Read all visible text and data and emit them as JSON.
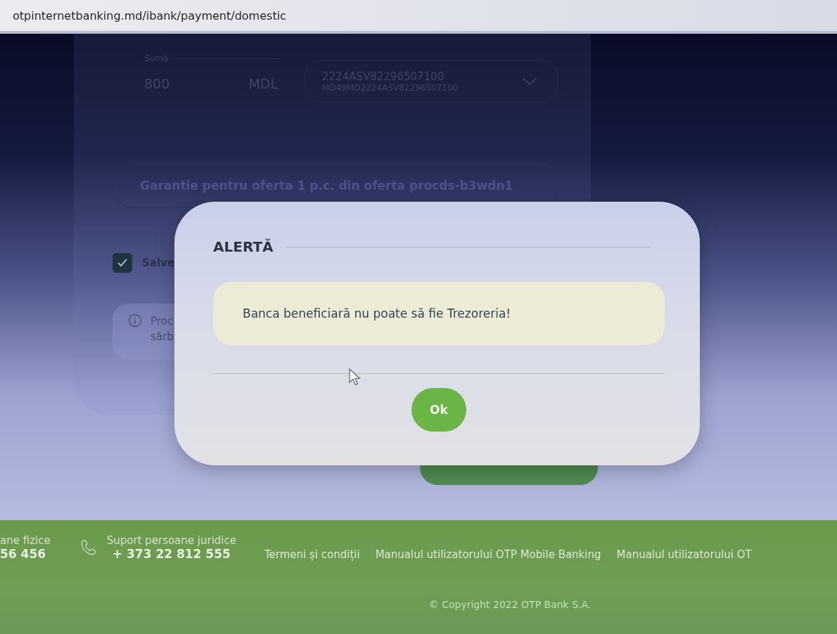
{
  "address_bar": {
    "url": "otpinternetbanking.md/ibank/payment/domestic"
  },
  "payment_form": {
    "amount": {
      "label": "Sumă",
      "value": "800",
      "currency": "MDL"
    },
    "account": {
      "number": "2224ASV82296507100",
      "iban": "MD49MO2224ASV82296507100"
    },
    "details": {
      "value": "Garantie pentru oferta 1 p.c. din oferta procds-b3wdn1"
    },
    "save_checkbox": {
      "label": "Salve",
      "checked": true
    },
    "info": {
      "lines": [
        "Proc",
        "sărb"
      ]
    }
  },
  "alert": {
    "title": "ALERTĂ",
    "message": "Banca beneficiară nu poate să fie Trezoreria!",
    "button": "Ok"
  },
  "footer": {
    "contacts": [
      {
        "label": "ane fizice",
        "phone": "56 456"
      },
      {
        "label": "Suport persoane juridice",
        "phone": "+ 373 22 812 555"
      }
    ],
    "links": [
      "Termeni și condiții",
      "Manualul utilizatorului OTP Mobile Banking",
      "Manualul utilizatorului OT"
    ],
    "copyright": "© Copyright 2022 OTP Bank S.A."
  }
}
